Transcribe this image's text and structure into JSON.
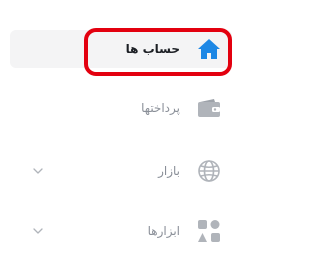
{
  "menu": {
    "items": [
      {
        "label": "حساب ها",
        "icon": "home-icon",
        "active": true,
        "expandable": false
      },
      {
        "label": "پرداختها",
        "icon": "wallet-icon",
        "active": false,
        "expandable": false
      },
      {
        "label": "بازار",
        "icon": "globe-icon",
        "active": false,
        "expandable": true
      },
      {
        "label": "ابزارها",
        "icon": "tools-icon",
        "active": false,
        "expandable": true
      }
    ]
  },
  "colors": {
    "accent": "#1e88e5",
    "highlight": "#e3000f",
    "muted": "#b0b4ba",
    "active_bg": "#f4f4f5"
  }
}
